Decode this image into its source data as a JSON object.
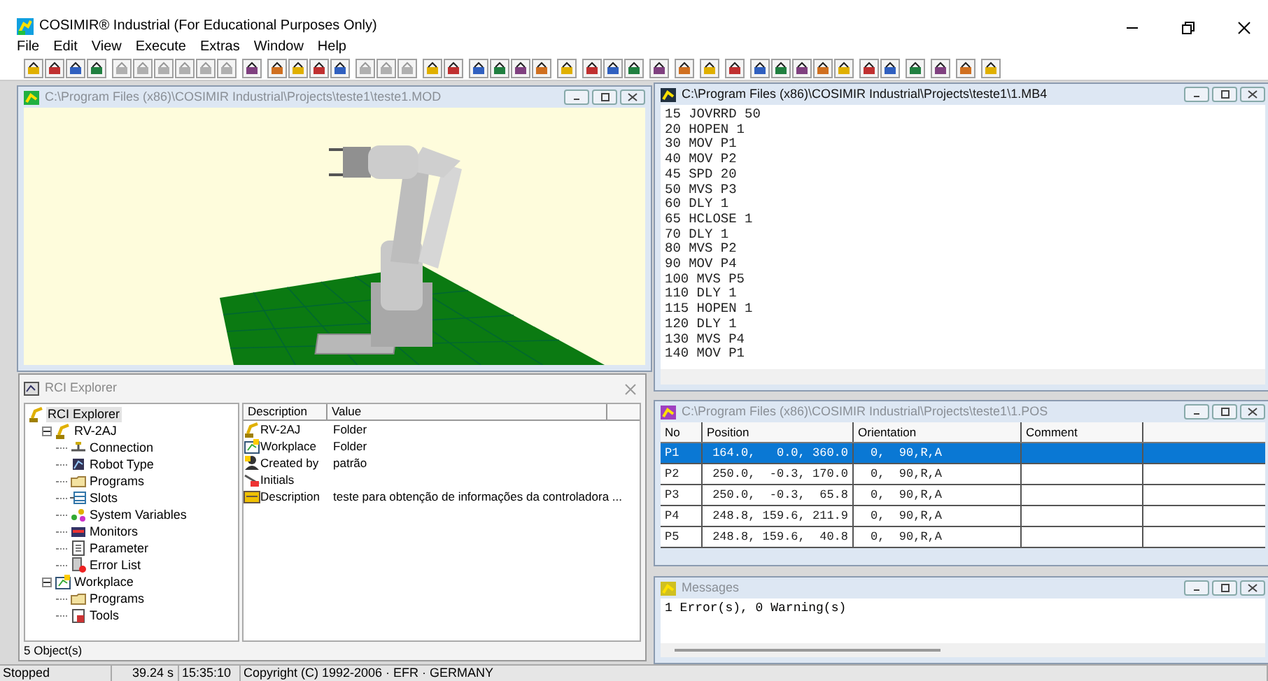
{
  "app": {
    "title": "COSIMIR® Industrial (For Educational Purposes Only)"
  },
  "menu": [
    "File",
    "Edit",
    "View",
    "Execute",
    "Extras",
    "Window",
    "Help"
  ],
  "model_window": {
    "title": "C:\\Program Files (x86)\\COSIMIR Industrial\\Projects\\teste1\\teste1.MOD",
    "active": false
  },
  "program_window": {
    "title": "C:\\Program Files (x86)\\COSIMIR Industrial\\Projects\\teste1\\1.MB4",
    "active": true,
    "lines": [
      "15 JOVRRD 50",
      "20 HOPEN 1",
      "30 MOV P1",
      "40 MOV P2",
      "45 SPD 20",
      "50 MVS P3",
      "60 DLY 1",
      "65 HCLOSE 1",
      "70 DLY 1",
      "80 MVS P2",
      "90 MOV P4",
      "100 MVS P5",
      "110 DLY 1",
      "115 HOPEN 1",
      "120 DLY 1",
      "130 MVS P4",
      "140 MOV P1"
    ]
  },
  "positions_window": {
    "title": "C:\\Program Files (x86)\\COSIMIR Industrial\\Projects\\teste1\\1.POS",
    "active": false,
    "columns": [
      "No",
      "Position",
      "Orientation",
      "Comment"
    ],
    "rows": [
      {
        "no": "P1",
        "position": "164.0,   0.0, 360.0",
        "orientation": "0,  90,R,A",
        "selected": true
      },
      {
        "no": "P2",
        "position": "250.0,  -0.3, 170.0",
        "orientation": "0,  90,R,A",
        "selected": false
      },
      {
        "no": "P3",
        "position": "250.0,  -0.3,  65.8",
        "orientation": "0,  90,R,A",
        "selected": false
      },
      {
        "no": "P4",
        "position": "248.8, 159.6, 211.9",
        "orientation": "0,  90,R,A",
        "selected": false
      },
      {
        "no": "P5",
        "position": "248.8, 159.6,  40.8",
        "orientation": "0,  90,R,A",
        "selected": false
      }
    ]
  },
  "messages_window": {
    "title": "Messages",
    "active": false,
    "lines": [
      "1 Error(s), 0 Warning(s)"
    ]
  },
  "explorer": {
    "title": "RCI Explorer",
    "tree": [
      {
        "label": "RCI Explorer",
        "kind": "robot",
        "selected": true,
        "children": [
          {
            "label": "RV-2AJ",
            "kind": "robot",
            "selected": false,
            "expanded": true,
            "children": [
              {
                "label": "Connection",
                "kind": "connection",
                "selected": false
              },
              {
                "label": "Robot Type",
                "kind": "robottype",
                "selected": false
              },
              {
                "label": "Programs",
                "kind": "folder",
                "selected": false
              },
              {
                "label": "Slots",
                "kind": "slots",
                "selected": false
              },
              {
                "label": "System Variables",
                "kind": "variables",
                "selected": false
              },
              {
                "label": "Monitors",
                "kind": "monitor",
                "selected": false
              },
              {
                "label": "Parameter",
                "kind": "parameter",
                "selected": false
              },
              {
                "label": "Error List",
                "kind": "errors",
                "selected": false
              }
            ]
          },
          {
            "label": "Workplace",
            "kind": "workplace",
            "selected": false,
            "expanded": true,
            "children": [
              {
                "label": "Programs",
                "kind": "folder",
                "selected": false
              },
              {
                "label": "Tools",
                "kind": "tools",
                "selected": false
              }
            ]
          }
        ]
      }
    ],
    "columns": [
      "Description",
      "Value"
    ],
    "rows": [
      {
        "kind": "robot",
        "description": "RV-2AJ",
        "value": "Folder"
      },
      {
        "kind": "workplace",
        "description": "Workplace",
        "value": "Folder"
      },
      {
        "kind": "person",
        "description": "Created by",
        "value": "patrão"
      },
      {
        "kind": "initials",
        "description": "Initials"
      },
      {
        "kind": "description",
        "description": "Description",
        "value": "teste para obtenção de informações da controladora ..."
      }
    ],
    "status": "5 Object(s)"
  },
  "status_bar": [
    "Stopped",
    "39.24 s",
    "15:35:10",
    "Copyright (C) 1992-2006 · EFR · GERMANY"
  ]
}
